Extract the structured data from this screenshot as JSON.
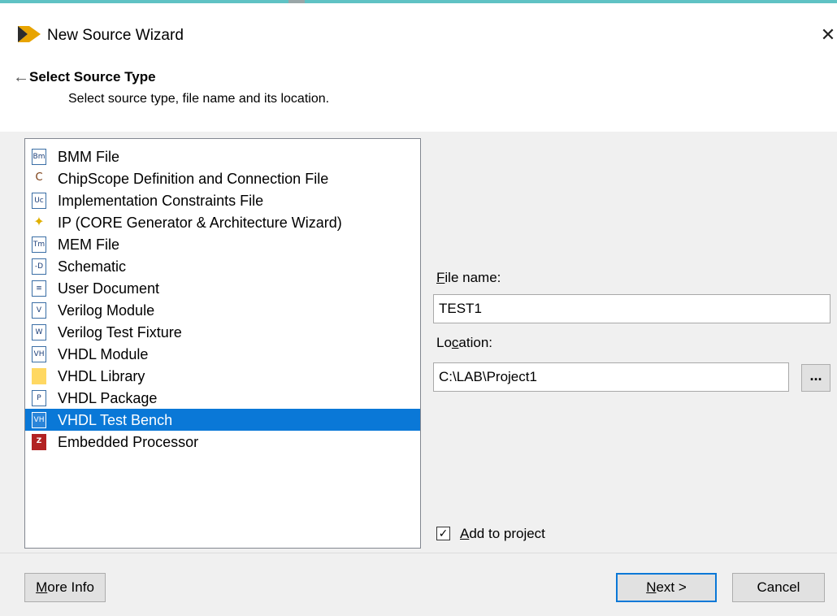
{
  "window": {
    "title": "New Source Wizard"
  },
  "page": {
    "heading": "Select Source Type",
    "subheading": "Select source type, file name and its location."
  },
  "source_types": [
    {
      "label": "BMM File",
      "icon": "bmm-file-icon",
      "glyph": "Bm",
      "selected": false
    },
    {
      "label": "ChipScope Definition and Connection File",
      "icon": "chipscope-icon",
      "glyph": "C",
      "selected": false
    },
    {
      "label": "Implementation Constraints File",
      "icon": "constraints-file-icon",
      "glyph": "Uc",
      "selected": false
    },
    {
      "label": "IP (CORE Generator & Architecture Wizard)",
      "icon": "ip-bulb-icon",
      "glyph": "✦",
      "selected": false
    },
    {
      "label": "MEM File",
      "icon": "mem-file-icon",
      "glyph": "Tm",
      "selected": false
    },
    {
      "label": "Schematic",
      "icon": "schematic-icon",
      "glyph": "-D",
      "selected": false
    },
    {
      "label": "User Document",
      "icon": "user-document-icon",
      "glyph": "≡",
      "selected": false
    },
    {
      "label": "Verilog Module",
      "icon": "verilog-module-icon",
      "glyph": "V",
      "selected": false
    },
    {
      "label": "Verilog Test Fixture",
      "icon": "verilog-test-fixture-icon",
      "glyph": "W",
      "selected": false
    },
    {
      "label": "VHDL Module",
      "icon": "vhdl-module-icon",
      "glyph": "VH",
      "selected": false
    },
    {
      "label": "VHDL Library",
      "icon": "vhdl-library-icon",
      "glyph": "",
      "selected": false
    },
    {
      "label": "VHDL Package",
      "icon": "vhdl-package-icon",
      "glyph": "P",
      "selected": false
    },
    {
      "label": "VHDL Test Bench",
      "icon": "vhdl-test-bench-icon",
      "glyph": "VH",
      "selected": true
    },
    {
      "label": "Embedded Processor",
      "icon": "embedded-processor-icon",
      "glyph": "Z",
      "selected": false
    }
  ],
  "file_name": {
    "label_pre": "",
    "label_accel": "F",
    "label_post": "ile name:",
    "value": "TEST1"
  },
  "location": {
    "label_pre": "Lo",
    "label_accel": "c",
    "label_post": "ation:",
    "value": "C:\\LAB\\Project1",
    "browse_label": "..."
  },
  "add_to_project": {
    "label_accel": "A",
    "label_post": "dd to project",
    "checked": true,
    "check_glyph": "✓"
  },
  "buttons": {
    "more_info_accel": "M",
    "more_info_post": "ore Info",
    "next_accel": "N",
    "next_post": "ext >",
    "cancel": "Cancel"
  },
  "icons": {
    "close": "close-icon",
    "back": "back-arrow-icon",
    "logo": "xilinx-logo-icon"
  },
  "colors": {
    "selection": "#0a78d7",
    "accent_bar": "#5fc2c4"
  }
}
